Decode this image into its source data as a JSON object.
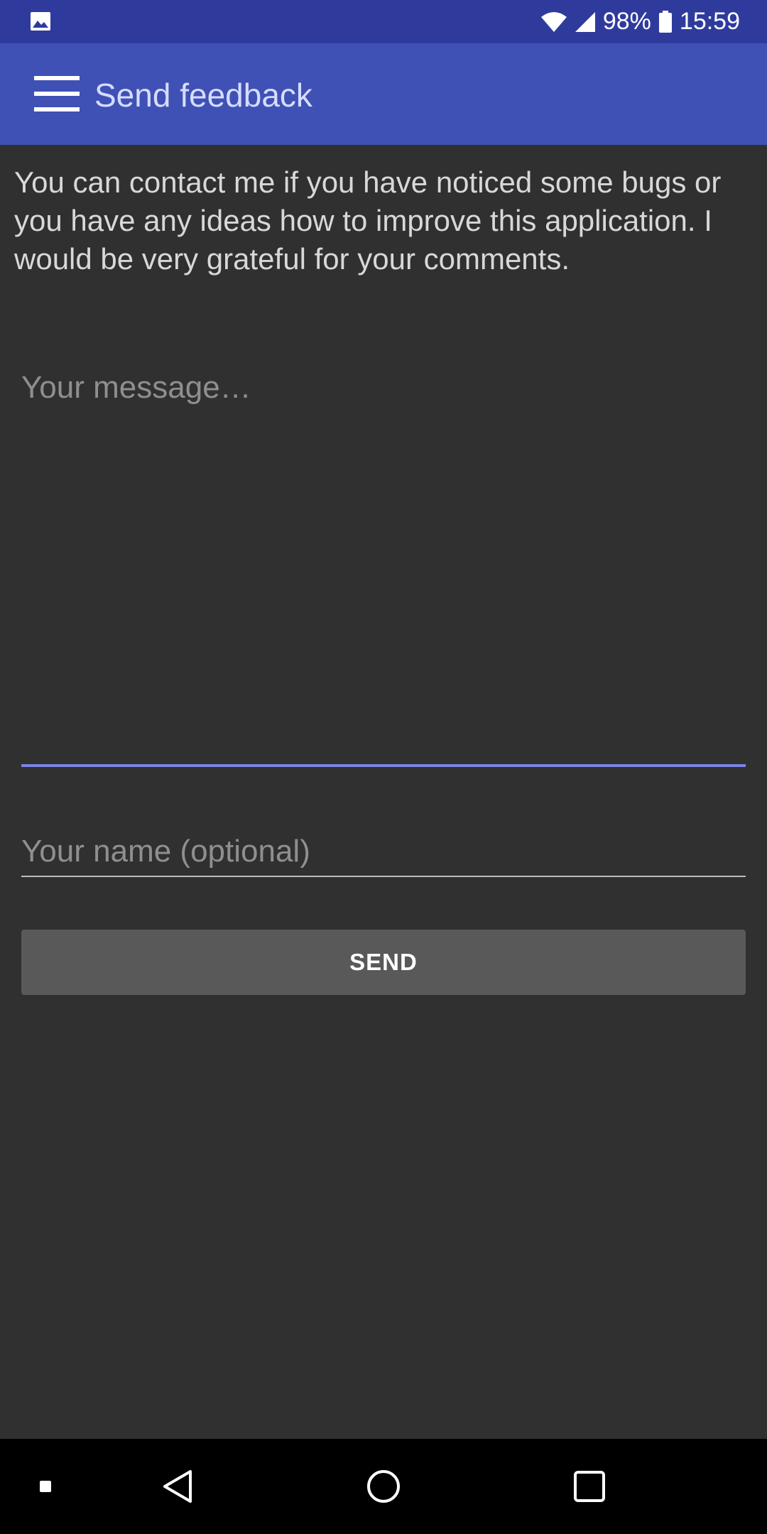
{
  "status_bar": {
    "left_icon": "image-icon",
    "battery_percent": "98%",
    "time": "15:59",
    "icons": [
      "wifi-icon",
      "signal-icon",
      "battery-icon"
    ]
  },
  "app_bar": {
    "menu_icon": "hamburger-menu-icon",
    "title": "Send feedback"
  },
  "main": {
    "intro": "You can contact me if you have noticed some bugs or you have any ideas how to improve this application. I would be very grateful for your comments.",
    "message_placeholder": "Your message…",
    "message_value": "",
    "name_placeholder": "Your name (optional)",
    "name_value": "",
    "send_label": "SEND"
  },
  "nav_bar": {
    "items": [
      "square-dot-icon",
      "back-icon",
      "home-icon",
      "recents-icon"
    ]
  },
  "colors": {
    "status_bar": "#2f3b9c",
    "app_bar": "#3f51b5",
    "background": "#303030",
    "focus_underline": "#7b84e6",
    "button": "#595959"
  }
}
